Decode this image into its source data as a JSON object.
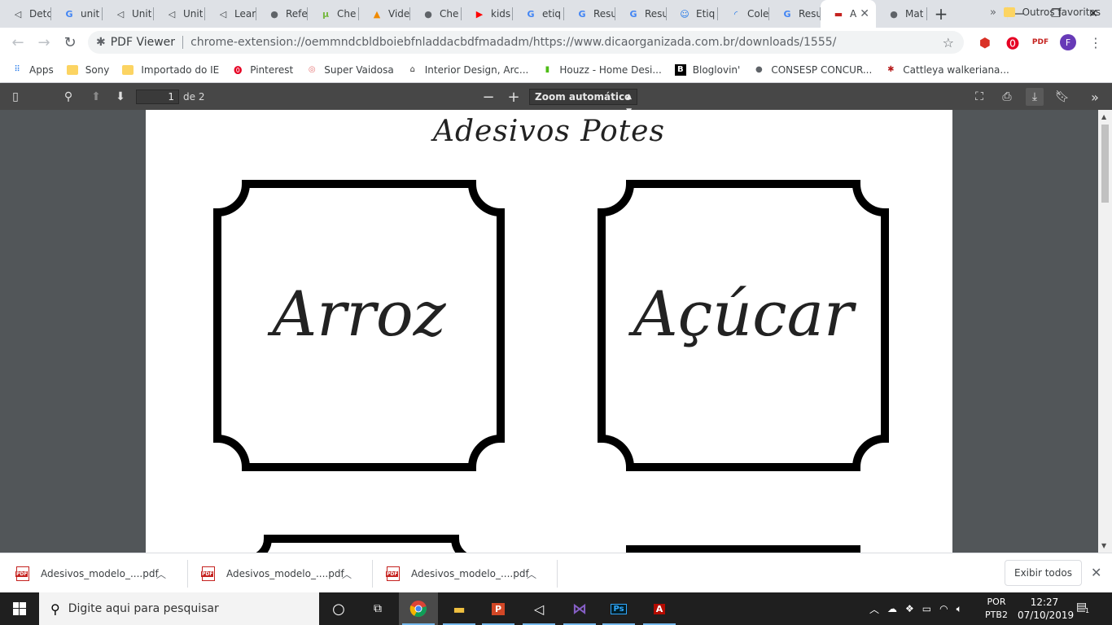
{
  "tabs": [
    {
      "title": "Detc",
      "icon": "unity-icon",
      "glyph": "◁",
      "color": "#3c4043"
    },
    {
      "title": "unit",
      "icon": "google-icon",
      "glyph": "G",
      "color": "#4285f4"
    },
    {
      "title": "Unit",
      "icon": "unity-icon",
      "glyph": "◁",
      "color": "#3c4043"
    },
    {
      "title": "Unit",
      "icon": "unity-icon",
      "glyph": "◁",
      "color": "#3c4043"
    },
    {
      "title": "Lear",
      "icon": "unity-icon",
      "glyph": "◁",
      "color": "#3c4043"
    },
    {
      "title": "Refe",
      "icon": "globe-icon",
      "glyph": "●",
      "color": "#5f6368"
    },
    {
      "title": "Che",
      "icon": "utorrent-icon",
      "glyph": "µ",
      "color": "#76b83f"
    },
    {
      "title": "Vide",
      "icon": "vlc-icon",
      "glyph": "▲",
      "color": "#f08a00"
    },
    {
      "title": "Che",
      "icon": "globe-icon",
      "glyph": "●",
      "color": "#5f6368"
    },
    {
      "title": "kids",
      "icon": "youtube-icon",
      "glyph": "▶",
      "color": "#ff0000"
    },
    {
      "title": "etiq",
      "icon": "google-icon",
      "glyph": "G",
      "color": "#4285f4"
    },
    {
      "title": "Resu",
      "icon": "google-icon",
      "glyph": "G",
      "color": "#4285f4"
    },
    {
      "title": "Resu",
      "icon": "google-icon",
      "glyph": "G",
      "color": "#4285f4"
    },
    {
      "title": "Etiq",
      "icon": "site-icon",
      "glyph": "☺",
      "color": "#1a73e8"
    },
    {
      "title": "Cole",
      "icon": "loading-icon",
      "glyph": "◜",
      "color": "#1a73e8"
    },
    {
      "title": "Resu",
      "icon": "google-icon",
      "glyph": "G",
      "color": "#4285f4"
    }
  ],
  "active_tab": {
    "title": "A",
    "icon": "pdf-icon",
    "glyph": "▬",
    "color": "#c5221f"
  },
  "last_tab": {
    "title": "Mat",
    "icon": "globe-icon",
    "glyph": "●",
    "color": "#5f6368"
  },
  "address": {
    "label": "PDF Viewer",
    "url": "chrome-extension://oemmndcbldboiebfnladdacbdfmadadm/https://www.dicaorganizada.com.br/downloads/1555/"
  },
  "bookmarks": [
    {
      "label": "Apps",
      "icon": "apps-grid-icon"
    },
    {
      "label": "Sony",
      "icon": "folder-icon"
    },
    {
      "label": "Importado do IE",
      "icon": "folder-icon"
    },
    {
      "label": "Pinterest",
      "icon": "pinterest-icon"
    },
    {
      "label": "Super Vaidosa",
      "icon": "super-vaidosa-icon"
    },
    {
      "label": "Interior Design, Arc...",
      "icon": "house-icon"
    },
    {
      "label": "Houzz - Home Desi...",
      "icon": "houzz-icon"
    },
    {
      "label": "Bloglovin'",
      "icon": "bloglovin-icon"
    },
    {
      "label": "CONSESP CONCUR...",
      "icon": "globe-icon"
    },
    {
      "label": "Cattleya walkeriana...",
      "icon": "orchid-icon"
    }
  ],
  "bookmarks_more": "»",
  "bookmarks_other": "Outros favoritos",
  "pdf_toolbar": {
    "page_current": "1",
    "page_of": "de 2",
    "zoom": "Zoom automático"
  },
  "pdf": {
    "title": "Adesivos Potes",
    "labels": [
      "Arroz",
      "Açúcar"
    ]
  },
  "downloads": [
    {
      "name": "Adesivos_modelo_....pdf"
    },
    {
      "name": "Adesivos_modelo_....pdf"
    },
    {
      "name": "Adesivos_modelo_....pdf"
    }
  ],
  "show_all": "Exibir todos",
  "taskbar": {
    "search_placeholder": "Digite aqui para pesquisar",
    "lang_line1": "POR",
    "lang_line2": "PTB2",
    "time": "12:27",
    "date": "07/10/2019",
    "notif_count": "1"
  }
}
